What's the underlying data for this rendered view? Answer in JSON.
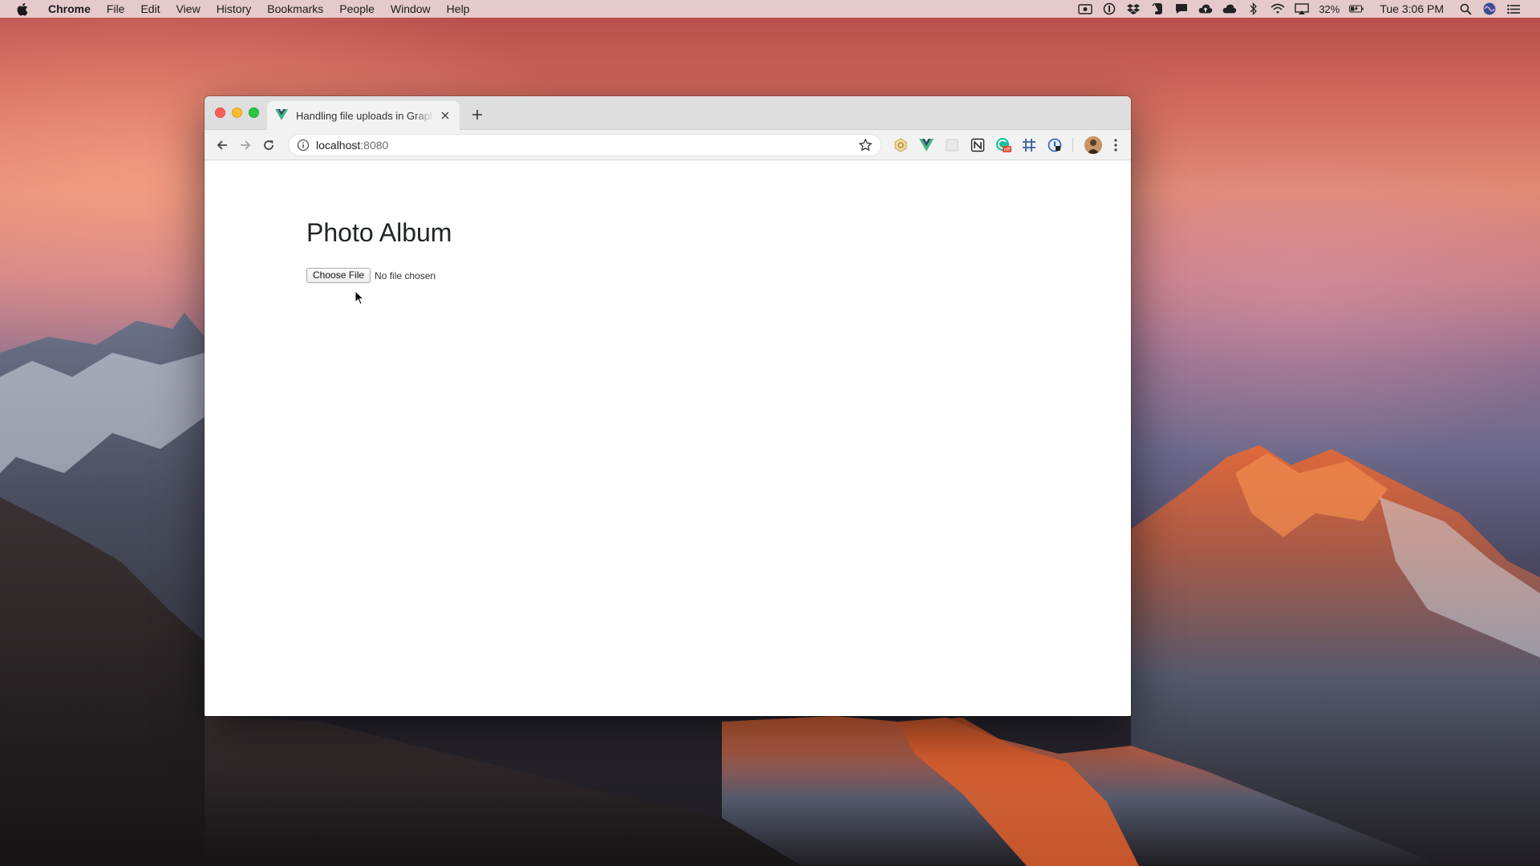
{
  "menubar": {
    "app_name": "Chrome",
    "menus": [
      "File",
      "Edit",
      "View",
      "History",
      "Bookmarks",
      "People",
      "Window",
      "Help"
    ],
    "tray_icons": [
      "screen-record-icon",
      "onepassword-icon",
      "dropbox-icon",
      "evernote-icon",
      "notification-icon",
      "cloud-upload-icon",
      "cloud-icon",
      "bluetooth-icon",
      "wifi-icon",
      "airplay-icon"
    ],
    "battery_percent": "32%",
    "clock": "Tue 3:06 PM"
  },
  "browser": {
    "tab_title": "Handling file uploads in GraphQL",
    "url_host": "localhost",
    "url_port": ":8080",
    "extensions": [
      "vue-devtools-icon",
      "extension-icon",
      "notion-icon",
      "grammarly-icon",
      "grid-icon",
      "onepassword-extension-icon"
    ]
  },
  "page": {
    "title": "Photo Album",
    "choose_file_label": "Choose File",
    "file_status": "No file chosen"
  },
  "colors": {
    "close": "#fc5f57",
    "minimize": "#fdbc2e",
    "maximize": "#28c840",
    "vue_green": "#41b883",
    "vue_dark": "#34495e"
  }
}
